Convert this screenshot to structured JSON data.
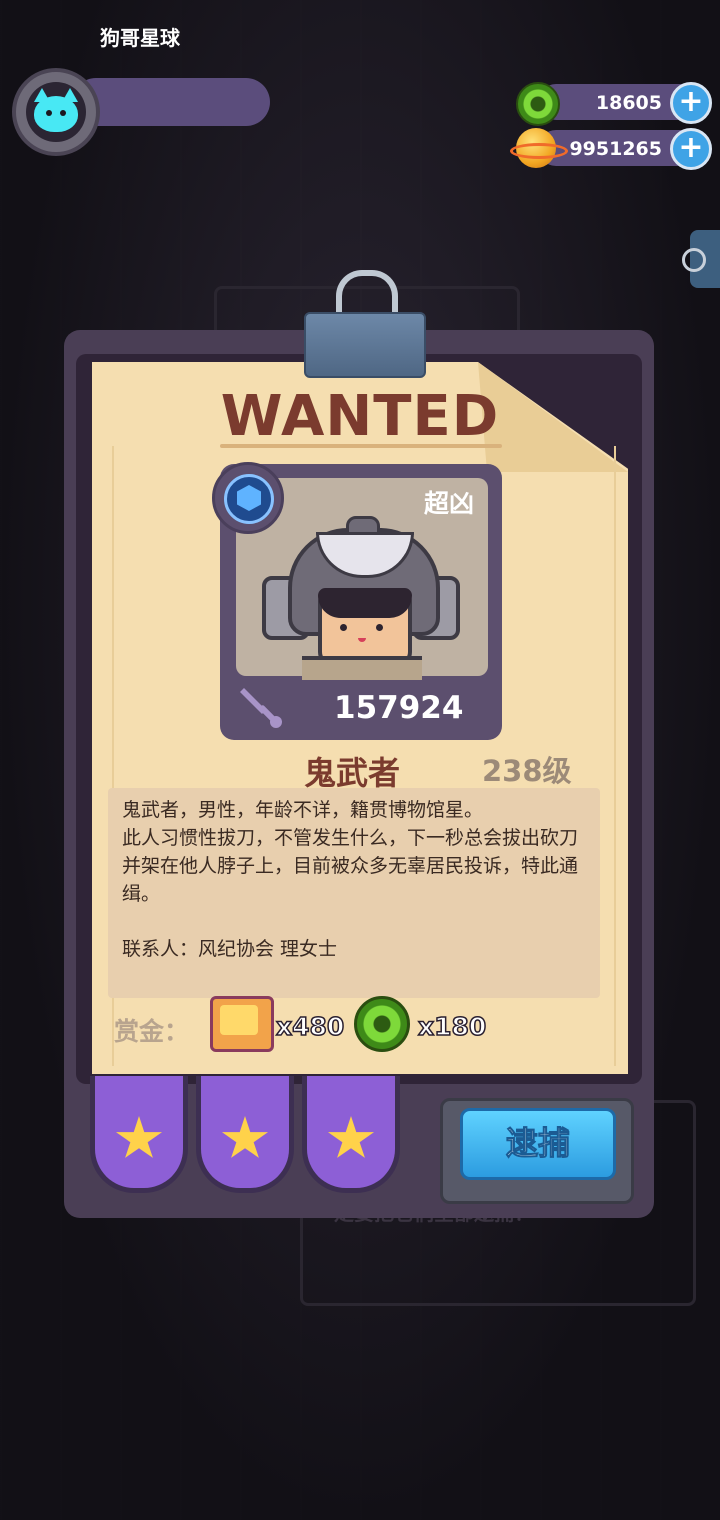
{
  "profile": {
    "name": "狗哥星球"
  },
  "currencies": [
    {
      "icon": "green-gem-coin-icon",
      "value": "18605"
    },
    {
      "icon": "planet-coin-icon",
      "value": "9951265"
    }
  ],
  "poster": {
    "title": "WANTED",
    "threat_label": "超凶",
    "power": "157924",
    "name": "鬼武者",
    "level": "238级",
    "description": "鬼武者，男性，年龄不详，籍贯博物馆星。\n此人习惯性拔刀，不管发生什么，下一秒总会拔出砍刀并架在他人脖子上，目前被众多无辜居民投诉，特此通缉。",
    "contact": "联系人：风纪协会 理女士",
    "reward_label": "赏金：",
    "rewards": [
      {
        "icon": "card-ticket-icon",
        "qty": "x480"
      },
      {
        "icon": "green-gem-coin-icon",
        "qty": "x180"
      }
    ]
  },
  "stars": 3,
  "arrest_button": "逮捕",
  "background_text": "定要把它们全部逮捕！",
  "colors": {
    "accent": "#5b4d7c",
    "title": "#7b3b2e",
    "button": "#2c9ce0",
    "star": "#ffd24a"
  }
}
